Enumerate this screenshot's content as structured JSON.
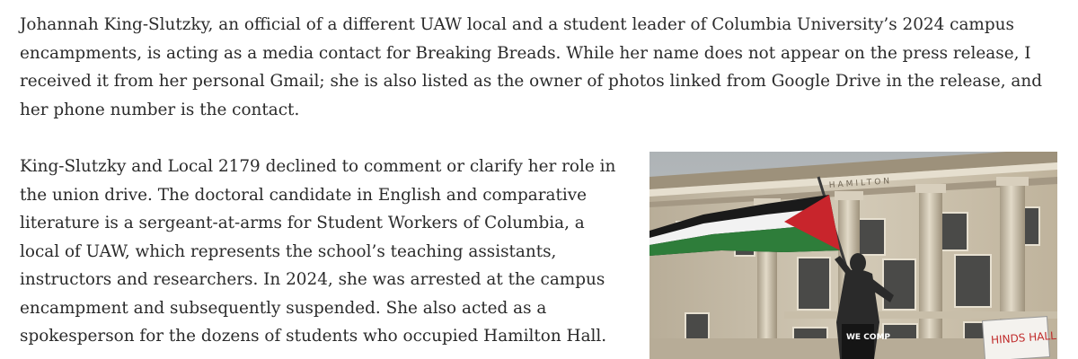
{
  "article": {
    "paragraph1": [
      "Johannah King-Slutzky, an official of a different UAW local and a student leader of Columbia University’s 2024 campus",
      "encampments, is acting as a media contact for Breaking Breads. While her name does not appear on the press release, I",
      "received it from her personal Gmail; she is also listed as the owner of photos linked from Google Drive in the release, and",
      "her phone number is the contact."
    ],
    "paragraph2": [
      "King-Slutzky and Local 2179 declined to comment or clarify her role in",
      "the union drive. The doctoral candidate in English and comparative",
      "literature is a sergeant-at-arms for Student Workers of Columbia, a",
      "local of UAW, which represents the school’s teaching assistants,",
      "instructors and researchers. In 2024, she was arrested at the campus",
      "encampment and subsequently suspended. She also acted as a",
      "spokesperson for the dozens of students who occupied Hamilton Hall."
    ]
  },
  "photo": {
    "building_inscription": "HAMILTON",
    "sign_left": "WE COMP",
    "sign_right": "HINDS HALL",
    "colors": {
      "flag_black": "#1a1a1a",
      "flag_white": "#f2f2f2",
      "flag_green": "#2e7d3a",
      "flag_red": "#c8252c",
      "stone": "#cfc6b3"
    }
  }
}
